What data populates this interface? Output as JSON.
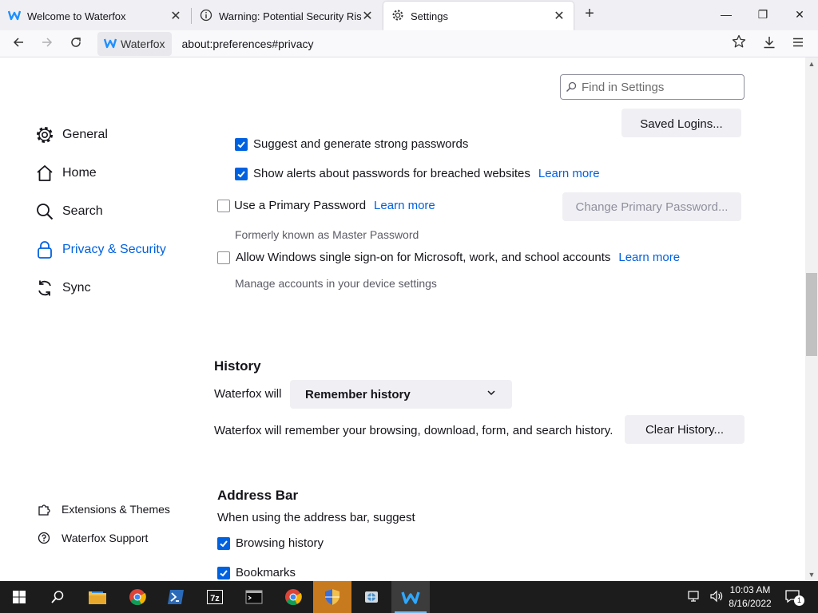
{
  "tabs": [
    {
      "label": "Welcome to Waterfox",
      "icon": "waterfox-icon"
    },
    {
      "label": "Warning: Potential Security Risk Ahead",
      "icon": "info-icon"
    },
    {
      "label": "Settings",
      "icon": "gear-icon"
    }
  ],
  "window_controls": {
    "minimize": "—",
    "maximize": "❐",
    "close": "✕"
  },
  "navbar": {
    "identity_label": "Waterfox",
    "url": "about:preferences#privacy"
  },
  "search": {
    "placeholder": "Find in Settings"
  },
  "sidebar": {
    "categories": [
      {
        "label": "General",
        "icon": "gear-icon"
      },
      {
        "label": "Home",
        "icon": "home-icon"
      },
      {
        "label": "Search",
        "icon": "search-icon"
      },
      {
        "label": "Privacy & Security",
        "icon": "lock-icon",
        "selected": true
      },
      {
        "label": "Sync",
        "icon": "sync-icon"
      }
    ],
    "footer": [
      {
        "label": "Extensions & Themes",
        "icon": "puzzle-icon"
      },
      {
        "label": "Waterfox Support",
        "icon": "help-icon"
      }
    ]
  },
  "logins": {
    "saved_logins_button": "Saved Logins...",
    "suggest_passwords": {
      "label": "Suggest and generate strong passwords",
      "checked": true
    },
    "breach_alerts": {
      "label": "Show alerts about passwords for breached websites",
      "checked": true,
      "link": "Learn more"
    },
    "primary_password": {
      "label": "Use a Primary Password",
      "checked": false,
      "link": "Learn more",
      "note": "Formerly known as Master Password",
      "button": "Change Primary Password..."
    },
    "windows_sso": {
      "label": "Allow Windows single sign-on for Microsoft, work, and school accounts",
      "checked": false,
      "link": "Learn more",
      "note": "Manage accounts in your device settings"
    }
  },
  "history": {
    "heading": "History",
    "will_label": "Waterfox will",
    "mode": "Remember history",
    "description": "Waterfox will remember your browsing, download, form, and search history.",
    "clear_button": "Clear History..."
  },
  "address_bar": {
    "heading": "Address Bar",
    "intro": "When using the address bar, suggest",
    "options": [
      {
        "label": "Browsing history",
        "checked": true
      },
      {
        "label": "Bookmarks",
        "checked": true
      }
    ]
  },
  "taskbar": {
    "apps": [
      "start-button",
      "search-icon",
      "file-explorer-icon",
      "chrome-icon",
      "powershell-icon",
      "7zip-icon",
      "terminal-icon",
      "chrome-icon",
      "security-shield-icon",
      "network-app-icon",
      "waterfox-icon"
    ],
    "time": "10:03 AM",
    "date": "8/16/2022",
    "notification_count": "1"
  },
  "colors": {
    "accent": "#0061e0",
    "taskbar": "#1c1c1c",
    "tabstrip": "#f0f0f4"
  }
}
